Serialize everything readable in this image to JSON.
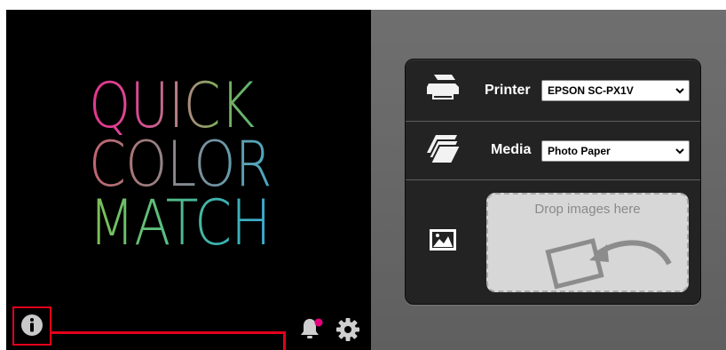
{
  "logo": {
    "line1": "QUICK",
    "line2": "COLOR",
    "line3": "MATCH"
  },
  "toolbar": {
    "info_icon": "info-circle-icon",
    "bell_icon": "bell-icon",
    "bell_badge_color": "#e6007e",
    "gear_icon": "gear-icon",
    "highlight_color": "#e3001b"
  },
  "settings": {
    "printer_label": "Printer",
    "printer_value": "EPSON SC-PX1V",
    "media_label": "Media",
    "media_value": "Photo Paper"
  },
  "drop": {
    "text": "Drop images here",
    "image_icon": "image-icon"
  }
}
